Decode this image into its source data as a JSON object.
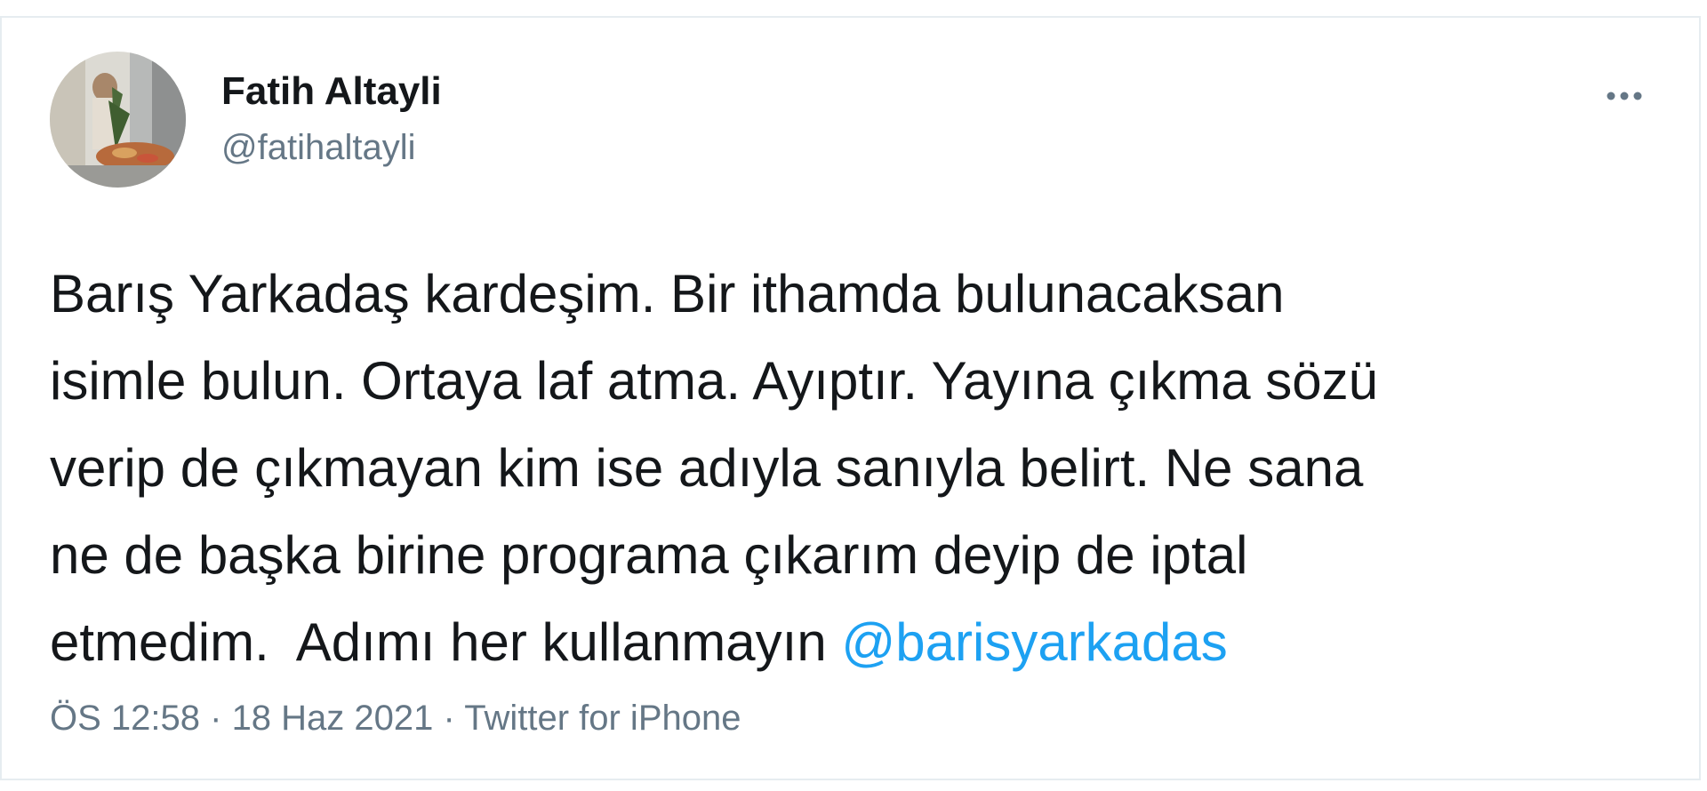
{
  "author": {
    "name": "Fatih Altayli",
    "handle": "@fatihaltayli",
    "avatar_icon": "profile-photo"
  },
  "menu": {
    "more_icon": "more-horizontal-icon",
    "more_label": "•••"
  },
  "tweet": {
    "lines": [
      "Barış Yarkadaş kardeşim. Bir ithamda bulunacaksan",
      "isimle bulun. Ortaya laf atma. Ayıptır. Yayına çıkma sözü",
      "verip de çıkmayan kim ise adıyla sanıyla belirt. Ne sana",
      "ne de başka birine programa çıkarım deyip de iptal",
      "etmedim.  Adımı her kullanmayın "
    ],
    "mention": "@barisyarkadas"
  },
  "meta": {
    "time": "ÖS 12:58",
    "separator": " · ",
    "date": "18 Haz 2021",
    "source": "Twitter for iPhone"
  },
  "colors": {
    "text": "#14171a",
    "secondary": "#657786",
    "link": "#1da1f2",
    "border": "#e6ecf0"
  }
}
